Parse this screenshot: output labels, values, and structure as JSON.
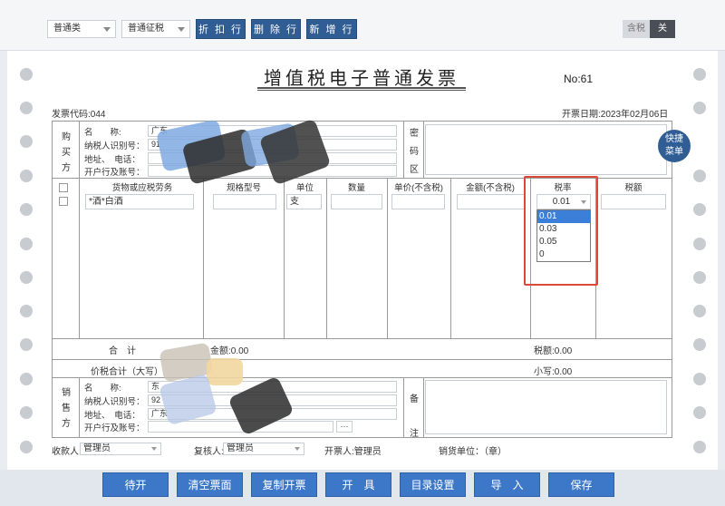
{
  "toolbar": {
    "invoice_kind": "普通类",
    "tax_kind": "普通征税",
    "discount_btn": "折 扣 行",
    "delete_btn": "删 除 行",
    "add_btn": "新 增 行",
    "tax_incl_label": "含税",
    "tax_incl_state": "关"
  },
  "invoice": {
    "title": "增值税电子普通发票",
    "no_label": "No:61",
    "code_label": "发票代码:044",
    "date_label": "开票日期:2023年02月06日"
  },
  "buyer": {
    "section_label": [
      "购",
      "买",
      "方"
    ],
    "name_label": "名　　称:",
    "name_value": "广东",
    "taxid_label": "纳税人识别号：",
    "taxid_value": "91",
    "addr_label": "地址、　电话：",
    "bank_label": "开户行及账号：",
    "cipher_label": [
      "密",
      "码",
      "区"
    ]
  },
  "items": {
    "headers": [
      "货物或应税劳务",
      "规格型号",
      "单位",
      "数量",
      "单价(不含税)",
      "金额(不含税)",
      "税率",
      "税额"
    ],
    "row1": {
      "name": "*酒*白酒",
      "model": "",
      "unit": "支",
      "qty": "",
      "price": "",
      "amount": "",
      "rate": "0.01",
      "tax": ""
    }
  },
  "rate_dropdown": {
    "options": [
      "0.01",
      "0.03",
      "0.05",
      "0"
    ],
    "selected": "0.01"
  },
  "totals": {
    "sum_label": "合　计",
    "amount_label": "金额:0.00",
    "tax_label": "税额:0.00",
    "total_label": "价税合计（大写）",
    "lower_label": "小写:0.00"
  },
  "seller": {
    "section_label": [
      "销",
      "售",
      "方"
    ],
    "name_label": "名　　称:",
    "name_value": "东",
    "taxid_label": "纳税人识别号：",
    "taxid_value": "92",
    "addr_label": "地址、　电话：",
    "addr_value": "广东",
    "bank_label": "开户行及账号：",
    "bank_btn": "···",
    "remark_label": [
      "备",
      "注"
    ]
  },
  "signers": {
    "payee_label": "收款人:",
    "payee": "管理员",
    "reviewer_label": "复核人:",
    "reviewer": "管理员",
    "drawer_label": "开票人:管理员",
    "seller_label": "销货单位：（章）"
  },
  "quick_menu": [
    "快捷",
    "菜单"
  ],
  "bottom_buttons": [
    "待开",
    "清空票面",
    "复制开票",
    "开　具",
    "目录设置",
    "导　入",
    "保存"
  ],
  "colors": {
    "accent": "#3d78c8",
    "highlight": "#d94a3a",
    "selected": "#3c7fd9"
  }
}
